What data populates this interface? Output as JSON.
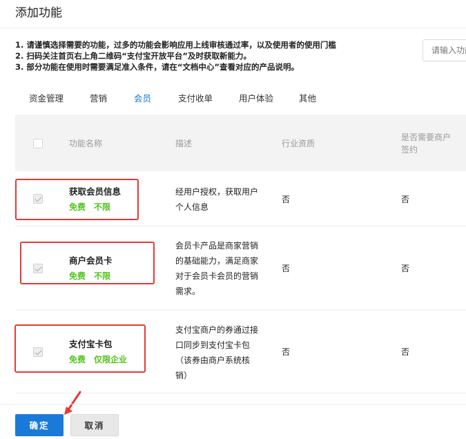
{
  "dialog": {
    "title": "添加功能"
  },
  "notes": [
    "1. 请谨慎选择需要的功能，过多的功能会影响应用上线审核通过率，以及使用者的使用门槛",
    "2. 扫码关注首页右上角二维码“支付宝开放平台”及时获取新能力。",
    "3. 部分功能在使用时需要满足准入条件，请在“文档中心”查看对应的产品说明。"
  ],
  "search": {
    "placeholder": "请输入功能"
  },
  "tabs": [
    "资金管理",
    "营销",
    "会员",
    "支付收单",
    "用户体验",
    "其他"
  ],
  "active_tab": "会员",
  "table": {
    "headers": {
      "name": "功能名称",
      "desc": "描述",
      "qual": "行业资质",
      "sign_line1": "是否需要商户",
      "sign_line2": "签约"
    },
    "rows": [
      {
        "name": "获取会员信息",
        "tags": [
          "免费",
          "不限"
        ],
        "desc_lines": [
          "经用户授权，获取用户",
          "个人信息"
        ],
        "qual": "否",
        "sign": "否"
      },
      {
        "name": "商户会员卡",
        "tags": [
          "免费",
          "不限"
        ],
        "desc_lines": [
          "会员卡产品是商家营销",
          "的基础能力，满足商家",
          "对于会员卡会员的营销",
          "需求。"
        ],
        "qual": "否",
        "sign": "否"
      },
      {
        "name": "支付宝卡包",
        "tags": [
          "免费",
          "仅限企业"
        ],
        "desc_lines": [
          "支付宝商户的券通过接",
          "口同步到支付宝卡包",
          "（该券由商户系统核",
          "销）"
        ],
        "qual": "否",
        "sign": "否"
      }
    ]
  },
  "footer": {
    "ok_label": "确定",
    "cancel_label": "取消"
  },
  "colors": {
    "primary": "#1a7ad9",
    "tag_green": "#52c41a",
    "highlight_red": "#e53935"
  }
}
